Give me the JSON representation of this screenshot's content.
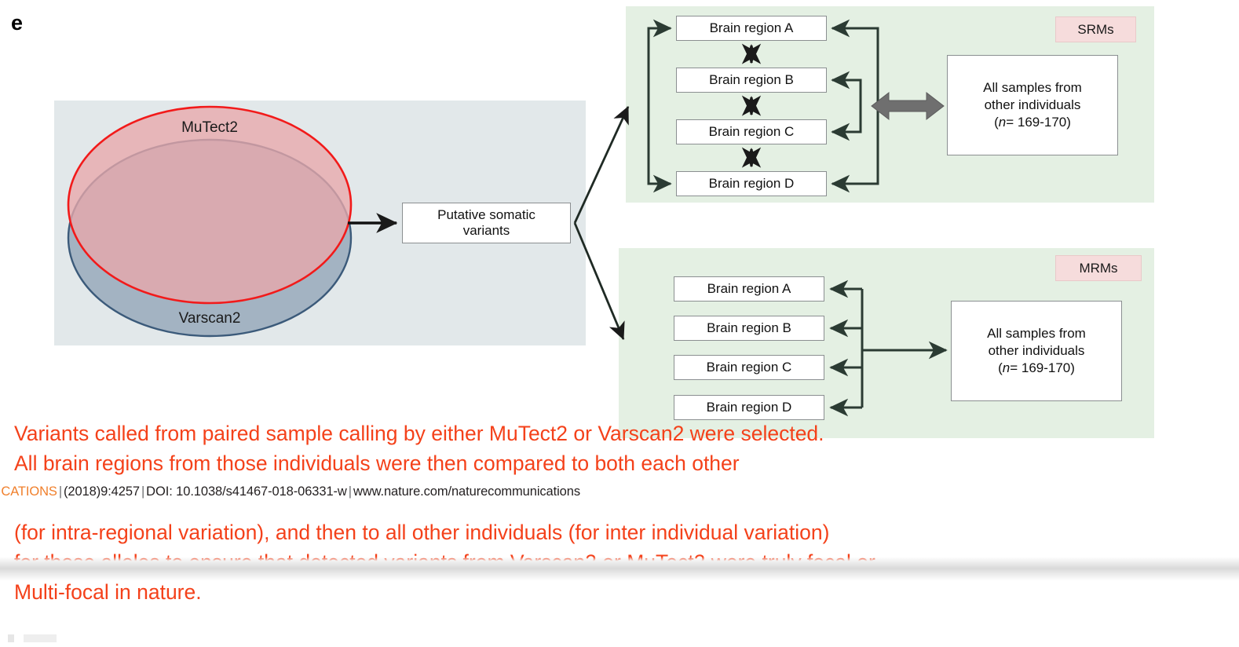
{
  "figure": {
    "panel_letter": "e"
  },
  "venn": {
    "top_label": "MuTect2",
    "bottom_label": "Varscan2",
    "top_stroke": "#f21a1a",
    "top_fill": "#f0bcbf",
    "bottom_stroke": "#3b5a7a",
    "bottom_fill": "#9fb0c0",
    "overlap_fill": "#a98b93",
    "background": "#e2e8ea"
  },
  "putative": {
    "line1": "Putative somatic",
    "line2": "variants"
  },
  "srm": {
    "tag": "SRMs",
    "background": "#e4f0e3",
    "tag_background": "#f6dcdc",
    "regions": [
      {
        "label": "Brain region A"
      },
      {
        "label": "Brain region B"
      },
      {
        "label": "Brain region C"
      },
      {
        "label": "Brain region D"
      }
    ],
    "samples": {
      "line1": "All samples from",
      "line2": "other individuals",
      "n_prefix": "(",
      "n_italic": "n",
      "n_value": "= 169-170)"
    }
  },
  "mrm": {
    "tag": "MRMs",
    "background": "#e4f0e3",
    "tag_background": "#f6dcdc",
    "regions": [
      {
        "label": "Brain region A"
      },
      {
        "label": "Brain region B"
      },
      {
        "label": "Brain region C"
      },
      {
        "label": "Brain region D"
      }
    ],
    "samples": {
      "line1": "All samples from",
      "line2": "other individuals",
      "n_prefix": "(",
      "n_italic": "n",
      "n_value": "= 169-170)"
    }
  },
  "annotations": {
    "color": "#f4411a",
    "block1_line1": "Variants called from paired sample calling by either MuTect2 or Varscan2 were selected.",
    "block1_line2": "All brain regions from those individuals were then compared to both each other",
    "block2_line1": "(for intra-regional variation), and then to all other individuals (for inter individual variation)",
    "block2_line2": "for those alleles to ensure that detected variants from Varscan2 or MuTect2 were truly focal or",
    "block2_line3": "Multi-focal in nature."
  },
  "footer": {
    "journal": "MMUNICATIONS",
    "issue": "(2018)9:4257",
    "doi": "DOI: 10.1038/s41467-018-06331-w",
    "url": "www.nature.com/naturecommunications",
    "separator": "|",
    "brand_color": "#f07f2b"
  }
}
